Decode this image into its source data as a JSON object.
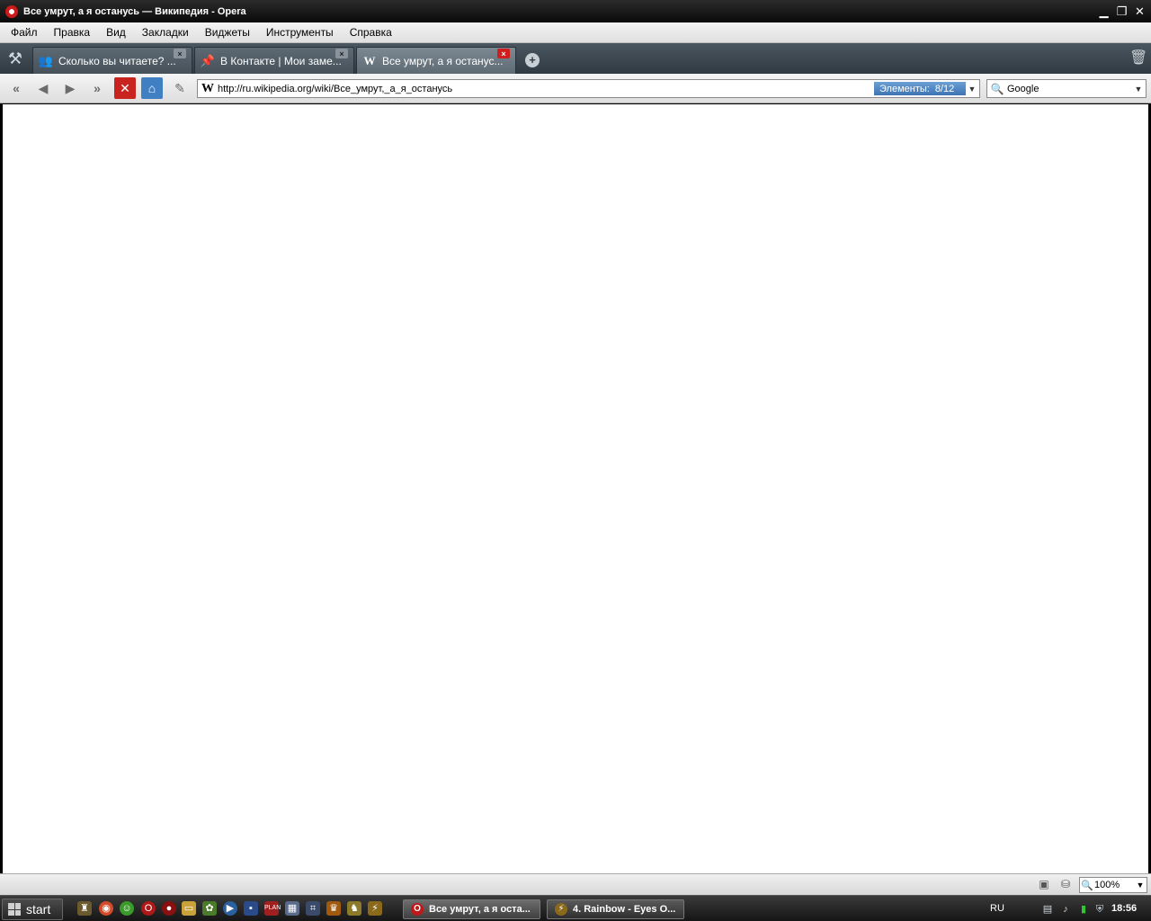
{
  "window": {
    "title": "Все умрут, а я останусь — Википедия - Opera",
    "minimize": "▁",
    "restore": "❐",
    "close": "✕"
  },
  "menu": [
    "Файл",
    "Правка",
    "Вид",
    "Закладки",
    "Виджеты",
    "Инструменты",
    "Справка"
  ],
  "tabs": [
    {
      "label": "Сколько вы читаете? ...",
      "icon": "community-icon",
      "glyph": "👥",
      "active": false
    },
    {
      "label": "В Контакте | Мои заме...",
      "icon": "pushpin-icon",
      "glyph": "📌",
      "active": false
    },
    {
      "label": "Все умрут, а я останус...",
      "icon": "wikipedia-icon",
      "glyph": "W",
      "active": true
    }
  ],
  "tab_close": "×",
  "new_tab": "+",
  "nav": {
    "rewind": "«",
    "back": "◀",
    "forward": "▶",
    "fast_forward": "»",
    "stop": "✕",
    "home": "⌂",
    "edit": "✎"
  },
  "address": {
    "favicon": "W",
    "url": "http://ru.wikipedia.org/wiki/Все_умрут,_а_я_останусь",
    "progress_label": "Элементы:",
    "progress_value": "8/12",
    "dropdown": "▼"
  },
  "search": {
    "engine": "Google",
    "dropdown": "▼"
  },
  "status": {
    "zoom": "100%",
    "dropdown": "▼"
  },
  "taskbar": {
    "start": "start",
    "tasks": [
      {
        "label": "Все умрут, а я оста...",
        "icon": "opera-icon",
        "active": true
      },
      {
        "label": "4. Rainbow - Eyes O...",
        "icon": "winamp-icon",
        "active": false
      }
    ],
    "lang": "RU",
    "clock": "18:56"
  },
  "colors": {
    "accent": "#3f7fc2",
    "stop": "#c8231f",
    "tab_close_active": "#d01e1e"
  }
}
